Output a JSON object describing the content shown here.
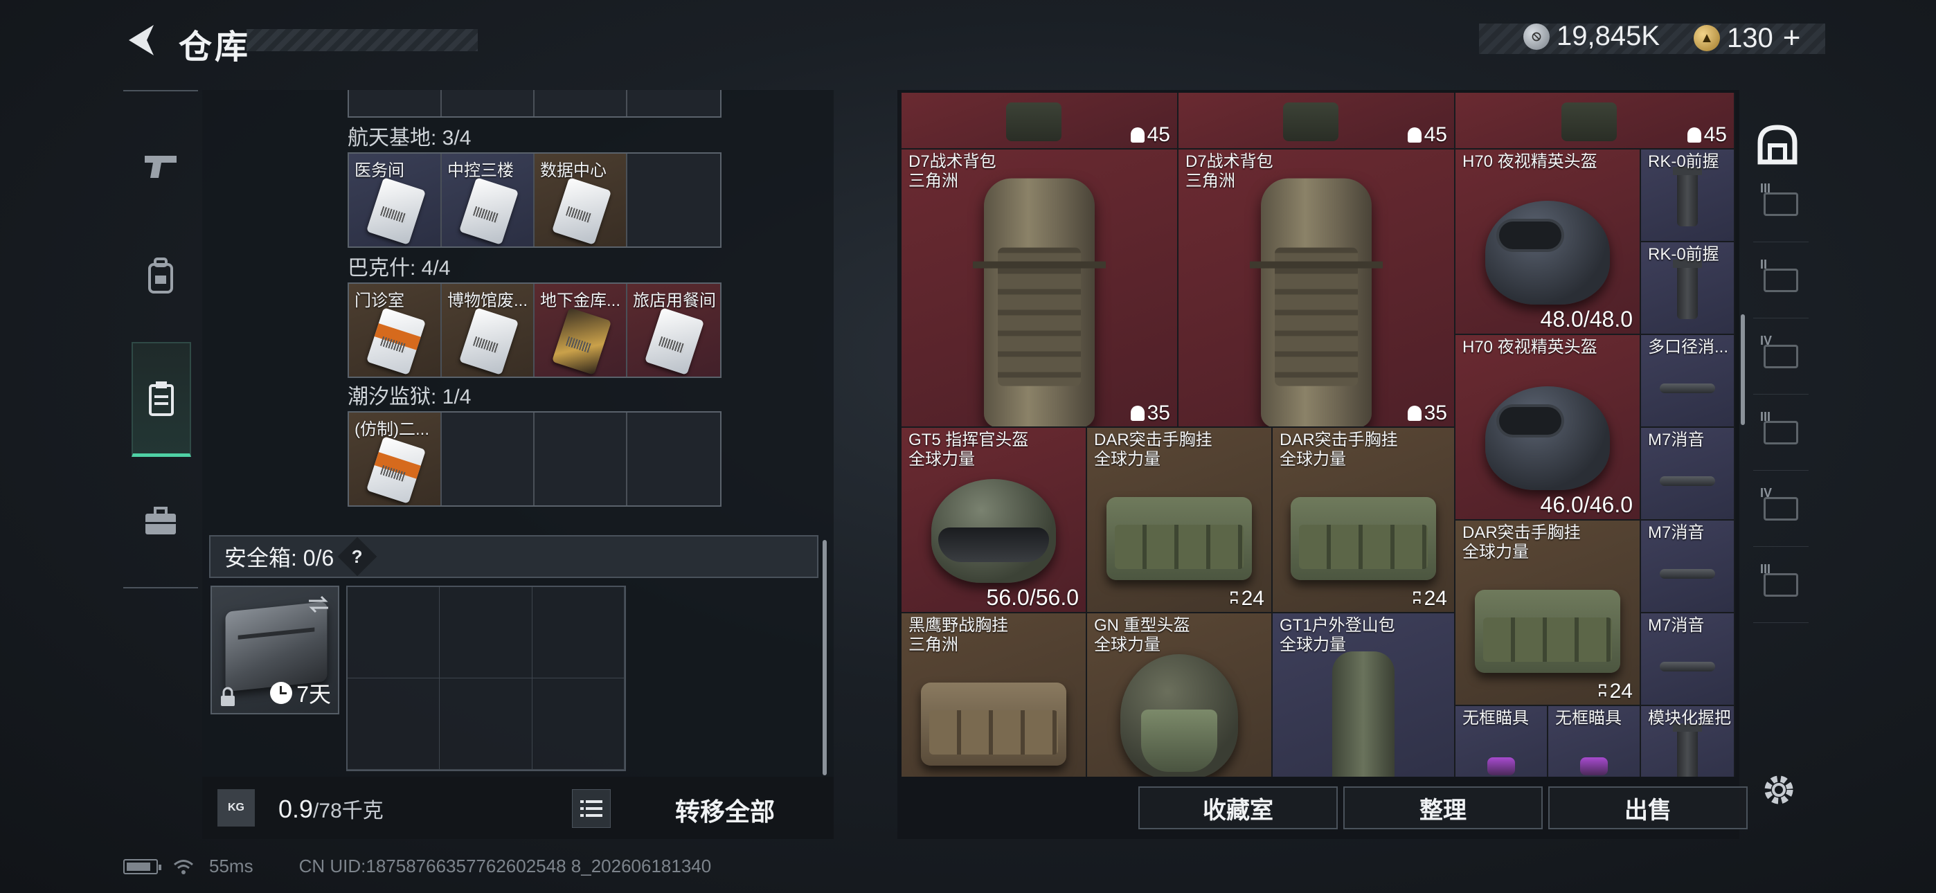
{
  "header": {
    "title": "仓库",
    "currency_silver": "19,845K",
    "currency_gold": "130",
    "currency_gold_plus": "+"
  },
  "left_nav": [
    {
      "name": "weapons",
      "icon": "pistol-icon"
    },
    {
      "name": "equipment",
      "icon": "backpack-icon"
    },
    {
      "name": "items",
      "icon": "clipboard-icon",
      "active": true
    },
    {
      "name": "cases",
      "icon": "briefcase-icon"
    }
  ],
  "keycards": {
    "section1": {
      "label": "航天基地: 3/4",
      "slots": [
        "医务间",
        "中控三楼",
        "数据中心",
        ""
      ]
    },
    "section2": {
      "label": "巴克什: 4/4",
      "slots": [
        "门诊室",
        "博物馆废...",
        "地下金库...",
        "旅店用餐间"
      ]
    },
    "section3": {
      "label": "潮汐监狱: 1/4",
      "slots": [
        "(仿制)二...",
        "",
        "",
        ""
      ]
    }
  },
  "safe_box": {
    "label": "安全箱: 0/6",
    "help": "?",
    "days": "7天"
  },
  "footer_left": {
    "weight_value": "0.9",
    "weight_max": "/78千克",
    "kg": "KG",
    "transfer_all": "转移全部"
  },
  "items": {
    "top_counts": [
      "45",
      "45",
      "45"
    ],
    "backpack1": {
      "name": "D7战术背包",
      "map": "三角洲",
      "count": "35"
    },
    "backpack2": {
      "name": "D7战术背包",
      "map": "三角洲",
      "count": "35"
    },
    "helmet_h70_a": {
      "name": "H70 夜视精英头盔",
      "durability": "48.0/48.0"
    },
    "helmet_h70_b": {
      "name": "H70 夜视精英头盔",
      "durability": "46.0/46.0"
    },
    "grip1": {
      "name": "RK-0前握"
    },
    "grip2": {
      "name": "RK-0前握"
    },
    "muzzle": {
      "name": "多口径消..."
    },
    "sup1": {
      "name": "M7消音"
    },
    "sup2": {
      "name": "M7消音"
    },
    "sup3": {
      "name": "M7消音"
    },
    "gt5": {
      "name": "GT5 指挥官头盔",
      "map": "全球力量",
      "durability": "56.0/56.0"
    },
    "dar1": {
      "name": "DAR突击手胸挂",
      "map": "全球力量",
      "count": "24"
    },
    "dar2": {
      "name": "DAR突击手胸挂",
      "map": "全球力量",
      "count": "24"
    },
    "dar3": {
      "name": "DAR突击手胸挂",
      "map": "全球力量",
      "count": "24"
    },
    "blackhawk": {
      "name": "黑鹰野战胸挂",
      "map": "三角洲"
    },
    "gn": {
      "name": "GN 重型头盔",
      "map": "全球力量"
    },
    "gt1": {
      "name": "GT1户外登山包",
      "map": "全球力量"
    },
    "scope1": {
      "name": "无框瞄具"
    },
    "scope2": {
      "name": "无框瞄具"
    },
    "modgrip": {
      "name": "模块化握把"
    }
  },
  "categories": [
    {
      "roman": "",
      "icon": "all-items-icon"
    },
    {
      "roman": "III",
      "icon": "medkit-icon"
    },
    {
      "roman": "II",
      "icon": "medkit-plus-icon"
    },
    {
      "roman": "IV",
      "icon": "case-icon"
    },
    {
      "roman": "III",
      "icon": "folder-icon"
    },
    {
      "roman": "IV",
      "icon": "folder-icon"
    },
    {
      "roman": "III",
      "icon": "rifle-icon"
    }
  ],
  "footer_right": {
    "collection": "收藏室",
    "organize": "整理",
    "sell": "出售"
  },
  "status": {
    "ping": "55ms",
    "uid": "CN UID:18758766357762602548 8_202606181340"
  },
  "colors": {
    "accent_green": "#4fd1a5",
    "rarity_red": "#5a2a2e",
    "rarity_brown": "#4c3e30",
    "rarity_blue": "#3a3f56"
  }
}
